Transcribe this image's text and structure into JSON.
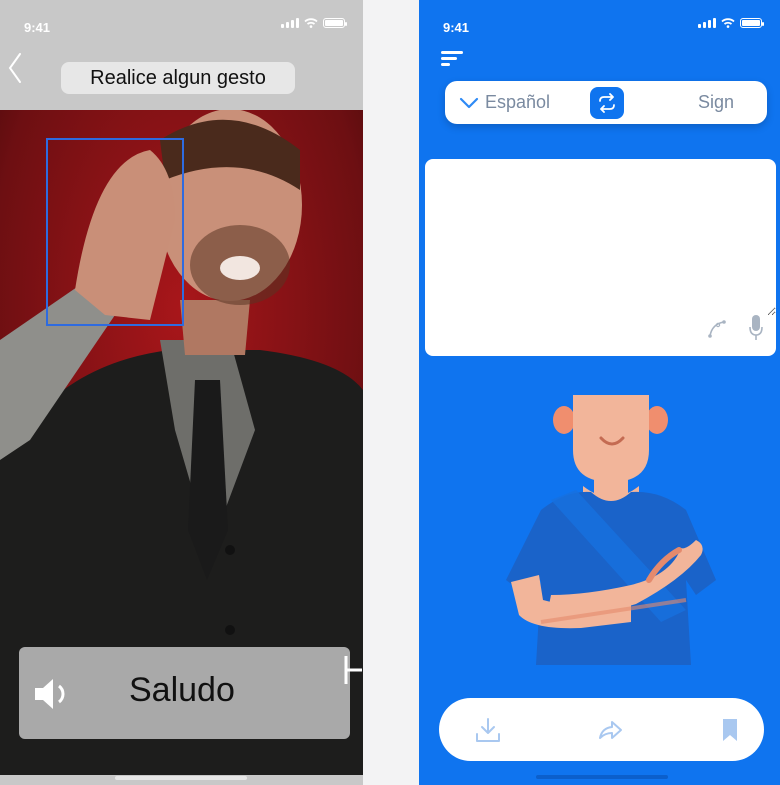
{
  "left_screen": {
    "status": {
      "time": "9:41"
    },
    "prompt": "Realice algun gesto",
    "result": {
      "text": "Saludo"
    }
  },
  "right_screen": {
    "status": {
      "time": "9:41"
    },
    "language_bar": {
      "source": "Español",
      "target": "Sign"
    },
    "input": {
      "value": "",
      "placeholder": ""
    }
  },
  "icons": {
    "back": "chevron-left-icon",
    "speaker": "speaker-icon",
    "menu": "menu-icon",
    "swap": "swap-icon",
    "draw": "draw-curve-icon",
    "mic": "microphone-icon",
    "download": "download-icon",
    "share": "share-icon",
    "bookmark": "bookmark-icon"
  },
  "colors": {
    "brand_blue": "#0f74ef",
    "detect_box": "#2e6be0",
    "muted_text": "#7a8aa0",
    "skin": "#f2b59a",
    "shirt": "#1a63c9"
  }
}
